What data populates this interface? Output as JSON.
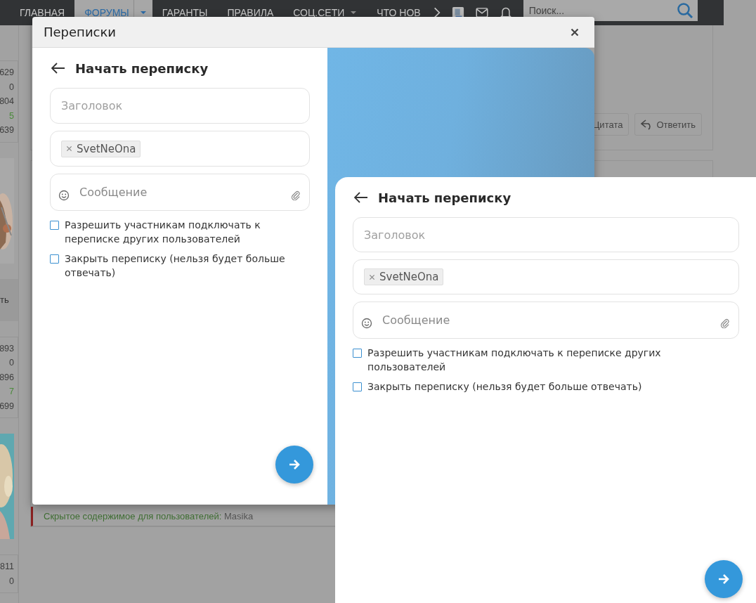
{
  "nav": {
    "items": [
      {
        "label": "ГЛАВНАЯ",
        "selected": false,
        "dropdown": false
      },
      {
        "label": "ФОРУМЫ",
        "selected": true,
        "dropdown": true
      },
      {
        "label": "ГАРАНТЫ",
        "selected": false,
        "dropdown": false
      },
      {
        "label": "ПРАВИЛА",
        "selected": false,
        "dropdown": false
      },
      {
        "label": "СОЦ.СЕТИ",
        "selected": false,
        "dropdown": true
      },
      {
        "label": "ЧТО НОВ",
        "selected": false,
        "dropdown": false
      }
    ],
    "search": {
      "placeholder": "Поиск..."
    }
  },
  "left_column": [
    {
      "kind": "stats",
      "values": [
        {
          "value": "629",
          "color": "#3d3d3d"
        },
        {
          "value": "0",
          "color": "#3d3d3d"
        },
        {
          "value": "804",
          "color": "#3d3d3d"
        },
        {
          "value": "5",
          "color": "#4a8a3a"
        },
        {
          "value": "639",
          "color": "#3d3d3d"
        }
      ]
    },
    {
      "kind": "picture"
    },
    {
      "kind": "button",
      "label": "ть"
    },
    {
      "kind": "stats",
      "values": [
        {
          "value": "893",
          "color": "#3d3d3d"
        },
        {
          "value": "0",
          "color": "#3d3d3d"
        },
        {
          "value": "896",
          "color": "#3d3d3d"
        },
        {
          "value": "7",
          "color": "#4a8a3a"
        },
        {
          "value": "699",
          "color": "#3d3d3d"
        }
      ]
    },
    {
      "kind": "picture"
    },
    {
      "kind": "stats",
      "values": [
        {
          "value": "811",
          "color": "#3d3d3d"
        },
        {
          "value": "0",
          "color": "#3d3d3d"
        }
      ]
    }
  ],
  "post_actions": [
    "Цитата",
    "Ответить"
  ],
  "hidden_content": {
    "text": "Скрытое содержимое для пользователей:",
    "user": "Masika"
  },
  "modal": {
    "title": "Переписки"
  },
  "forms": [
    {
      "heading": "Начать переписку",
      "title_placeholder": "Заголовок",
      "recipients": [
        "SvetNeOna"
      ],
      "message_placeholder": "Сообщение",
      "options": [
        {
          "label": "Разрешить участникам подключать к переписке других пользователей",
          "checked": false
        },
        {
          "label": "Закрыть переписку (нельзя будет больше отвечать)",
          "checked": false
        }
      ]
    },
    {
      "heading": "Начать переписку",
      "title_placeholder": "Заголовок",
      "recipients": [
        "SvetNeOna"
      ],
      "message_placeholder": "Сообщение",
      "options": [
        {
          "label": "Разрешить участникам подключать к переписке других пользователей",
          "checked": false
        },
        {
          "label": "Закрыть переписку (нельзя будет больше отвечать)",
          "checked": false
        }
      ]
    }
  ]
}
